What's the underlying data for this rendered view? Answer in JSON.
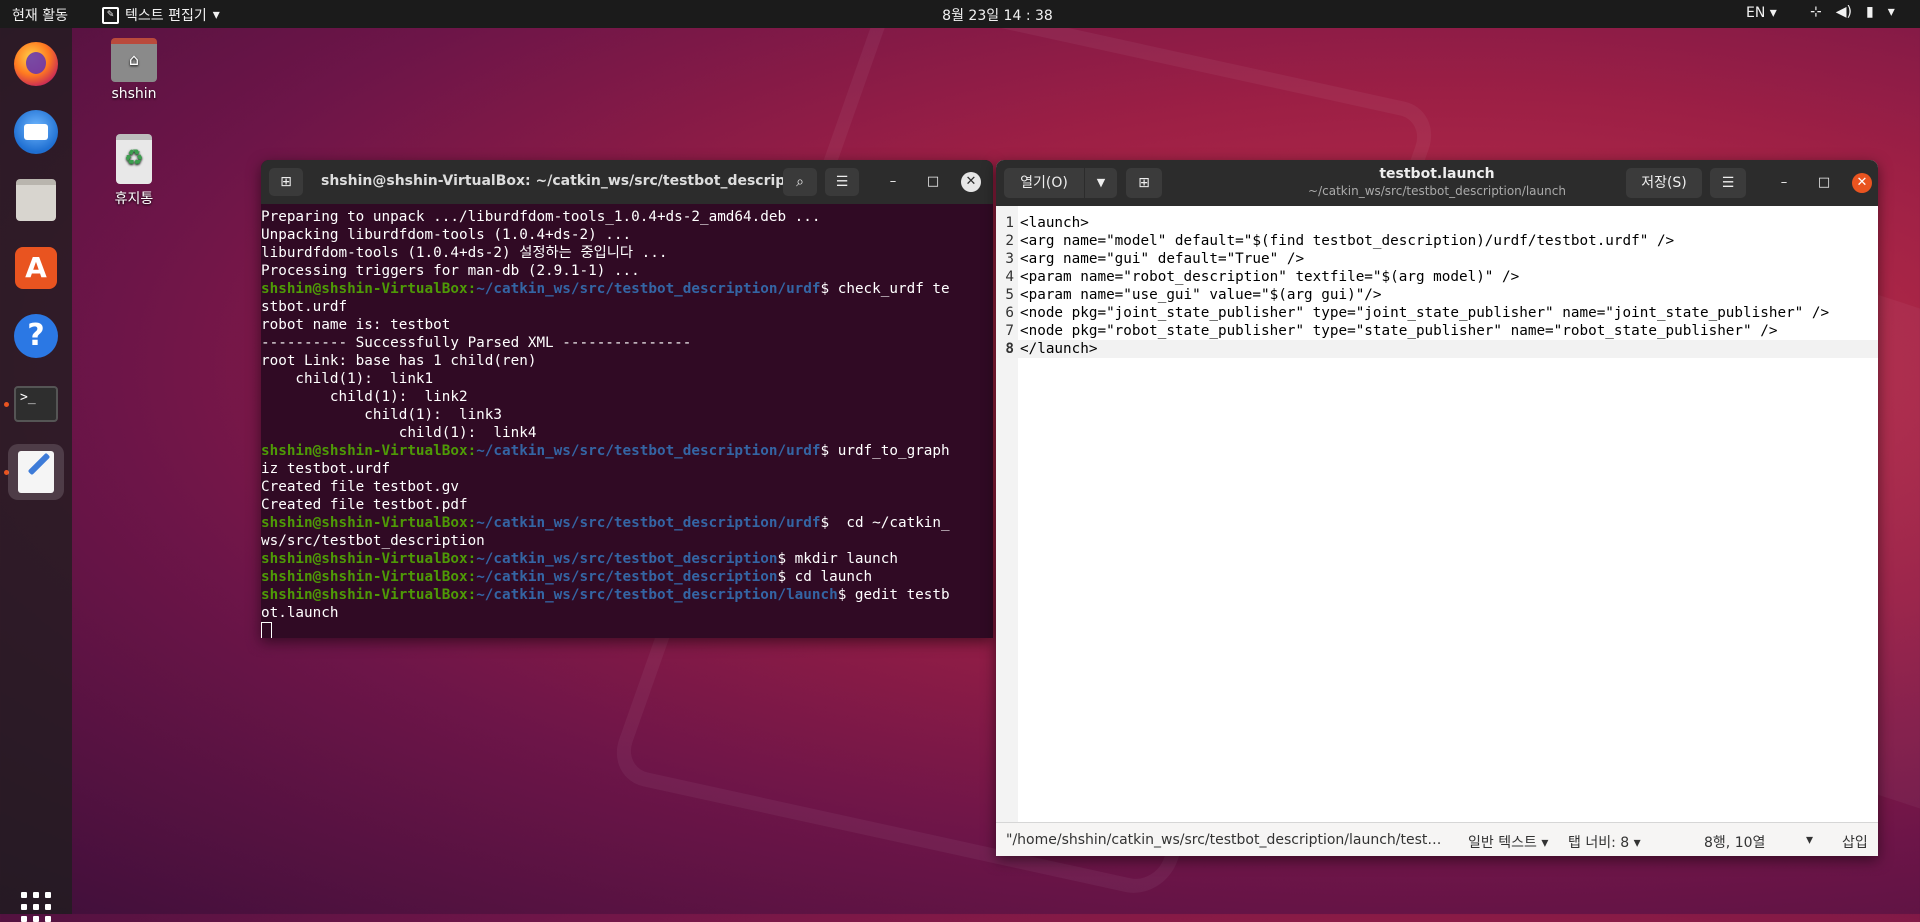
{
  "topbar": {
    "activities": "현재 활동",
    "app_name": "텍스트 편집기",
    "clock": "8월 23일  14 : 38",
    "lang": "EN"
  },
  "desktop": {
    "home_label": "shshin",
    "trash_label": "휴지통"
  },
  "terminal": {
    "title": "shshin@shshin-VirtualBox: ~/catkin_ws/src/testbot_descript...",
    "lines": [
      {
        "text": "Preparing to unpack .../liburdfdom-tools_1.0.4+ds-2_amd64.deb ..."
      },
      {
        "text": "Unpacking liburdfdom-tools (1.0.4+ds-2) ..."
      },
      {
        "text": "liburdfdom-tools (1.0.4+ds-2) 설정하는 중입니다 ..."
      },
      {
        "text": "Processing triggers for man-db (2.9.1-1) ..."
      },
      {
        "user": "shshin@shshin-VirtualBox",
        "path": "~/catkin_ws/src/testbot_description/urdf",
        "cmd": "$ check_urdf te"
      },
      {
        "text": "stbot.urdf"
      },
      {
        "text": "robot name is: testbot"
      },
      {
        "text": "---------- Successfully Parsed XML ---------------"
      },
      {
        "text": "root Link: base has 1 child(ren)"
      },
      {
        "text": "    child(1):  link1"
      },
      {
        "text": "        child(1):  link2"
      },
      {
        "text": "            child(1):  link3"
      },
      {
        "text": "                child(1):  link4"
      },
      {
        "user": "shshin@shshin-VirtualBox",
        "path": "~/catkin_ws/src/testbot_description/urdf",
        "cmd": "$ urdf_to_graph"
      },
      {
        "text": "iz testbot.urdf"
      },
      {
        "text": "Created file testbot.gv"
      },
      {
        "text": "Created file testbot.pdf"
      },
      {
        "user": "shshin@shshin-VirtualBox",
        "path": "~/catkin_ws/src/testbot_description/urdf",
        "cmd": "$  cd ~/catkin_"
      },
      {
        "text": "ws/src/testbot_description"
      },
      {
        "user": "shshin@shshin-VirtualBox",
        "path": "~/catkin_ws/src/testbot_description",
        "cmd": "$ mkdir launch"
      },
      {
        "user": "shshin@shshin-VirtualBox",
        "path": "~/catkin_ws/src/testbot_description",
        "cmd": "$ cd launch"
      },
      {
        "user": "shshin@shshin-VirtualBox",
        "path": "~/catkin_ws/src/testbot_description/launch",
        "cmd": "$ gedit testb"
      },
      {
        "text": "ot.launch"
      }
    ]
  },
  "gedit": {
    "open_label": "열기(O)",
    "save_label": "저장(S)",
    "doc_title": "testbot.launch",
    "doc_path": "~/catkin_ws/src/testbot_description/launch",
    "code_lines": [
      {
        "n": "1",
        "t": "<launch>"
      },
      {
        "n": "2",
        "t": "<arg name=\"model\" default=\"$(find testbot_description)/urdf/testbot.urdf\" />"
      },
      {
        "n": "3",
        "t": "<arg name=\"gui\" default=\"True\" />"
      },
      {
        "n": "4",
        "t": "<param name=\"robot_description\" textfile=\"$(arg model)\" />"
      },
      {
        "n": "5",
        "t": "<param name=\"use_gui\" value=\"$(arg gui)\"/>"
      },
      {
        "n": "6",
        "t": "<node pkg=\"joint_state_publisher\" type=\"joint_state_publisher\" name=\"joint_state_publisher\" />"
      },
      {
        "n": "7",
        "t": "<node pkg=\"robot_state_publisher\" type=\"state_publisher\" name=\"robot_state_publisher\" />"
      },
      {
        "n": "8",
        "t": "</launch>"
      }
    ],
    "status": {
      "path": "\"/home/shshin/catkin_ws/src/testbot_description/launch/testb...",
      "syntax": "일반 텍스트",
      "tab_width": "탭 너비: 8",
      "position": "8행, 10열",
      "mode": "삽입"
    }
  },
  "colors": {
    "accent": "#e95420",
    "terminal_bg": "#300a24",
    "prompt_user": "#4e9a06",
    "prompt_path": "#3465a4"
  }
}
